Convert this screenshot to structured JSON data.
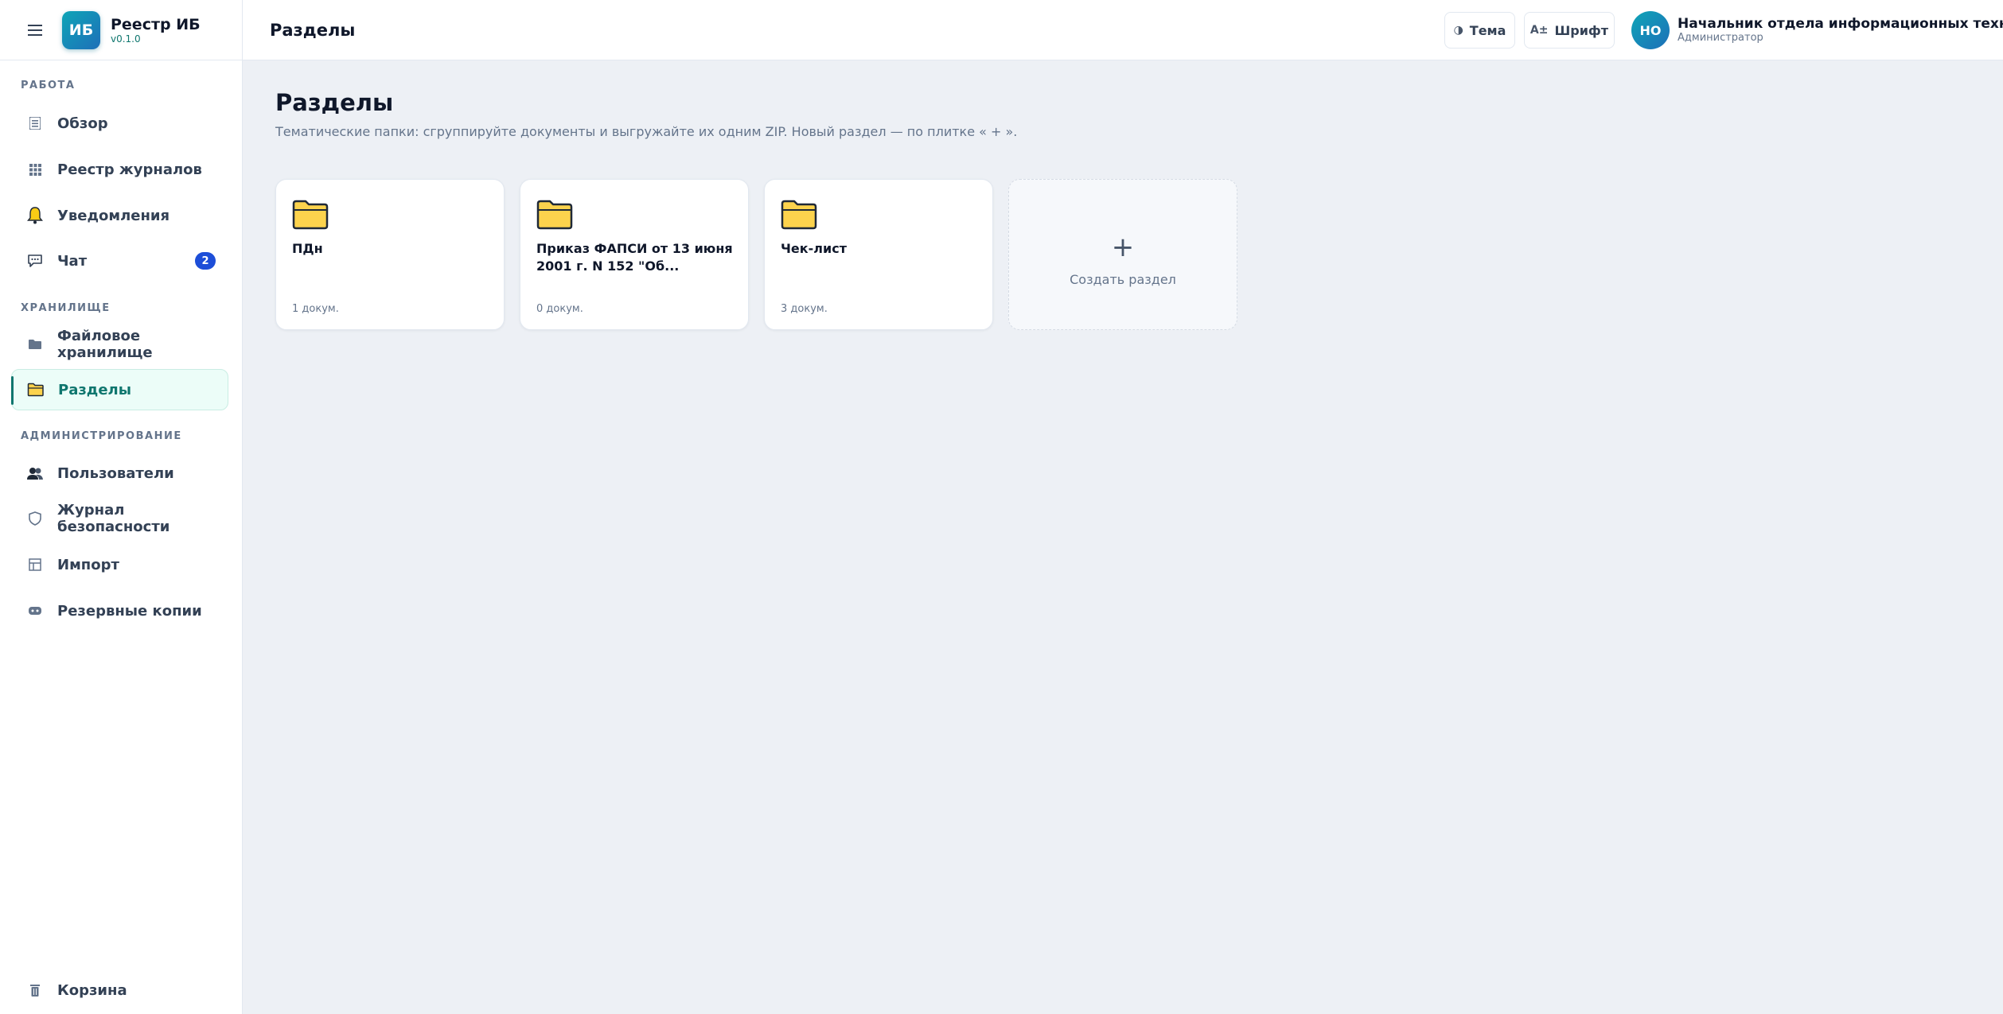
{
  "brand": {
    "logo": "ИБ",
    "name": "Реестр ИБ",
    "version": "v0.1.0"
  },
  "sidebar": {
    "sections": [
      {
        "title": "РАБОТА"
      },
      {
        "title": "ХРАНИЛИЩЕ"
      },
      {
        "title": "АДМИНИСТРИРОВАНИЕ"
      }
    ],
    "items": [
      {
        "label": "Обзор",
        "icon": "list-icon"
      },
      {
        "label": "Реестр журналов",
        "icon": "grid-icon"
      },
      {
        "label": "Уведомления",
        "icon": "bell-icon"
      },
      {
        "label": "Чат",
        "icon": "chat-icon",
        "badge": "2"
      },
      {
        "label": "Файловое хранилище",
        "icon": "folder-icon"
      },
      {
        "label": "Разделы",
        "icon": "folder-open-icon",
        "active": true
      },
      {
        "label": "Пользователи",
        "icon": "users-icon"
      },
      {
        "label": "Журнал безопасности",
        "icon": "shield-icon"
      },
      {
        "label": "Импорт",
        "icon": "table-icon"
      },
      {
        "label": "Резервные копии",
        "icon": "backup-icon"
      },
      {
        "label": "Корзина",
        "icon": "trash-icon"
      }
    ]
  },
  "topbar": {
    "title": "Разделы",
    "theme_label": "Тема",
    "theme_glyph": "◑",
    "font_label": "Шрифт",
    "font_glyph": "A±",
    "user": {
      "initials": "НО",
      "name": "Начальник отдела информационных технологий",
      "role": "Администратор"
    }
  },
  "main": {
    "title": "Разделы",
    "subtitle": "Тематические папки: сгруппируйте документы и выгружайте их одним ZIP. Новый раздел — по плитке « + ».",
    "cards": [
      {
        "name": "ПДн",
        "count": "1 докум."
      },
      {
        "name": "Приказ ФАПСИ от 13 июня 2001 г. N 152 \"Об...",
        "count": "0 докум."
      },
      {
        "name": "Чек-лист",
        "count": "3 докум."
      }
    ],
    "add_card": {
      "plus": "+",
      "label": "Создать раздел"
    }
  },
  "colors": {
    "accent": "#0f766e",
    "badge": "#1d4ed8",
    "folder": "#fcd34d",
    "background": "#edf0f5"
  }
}
